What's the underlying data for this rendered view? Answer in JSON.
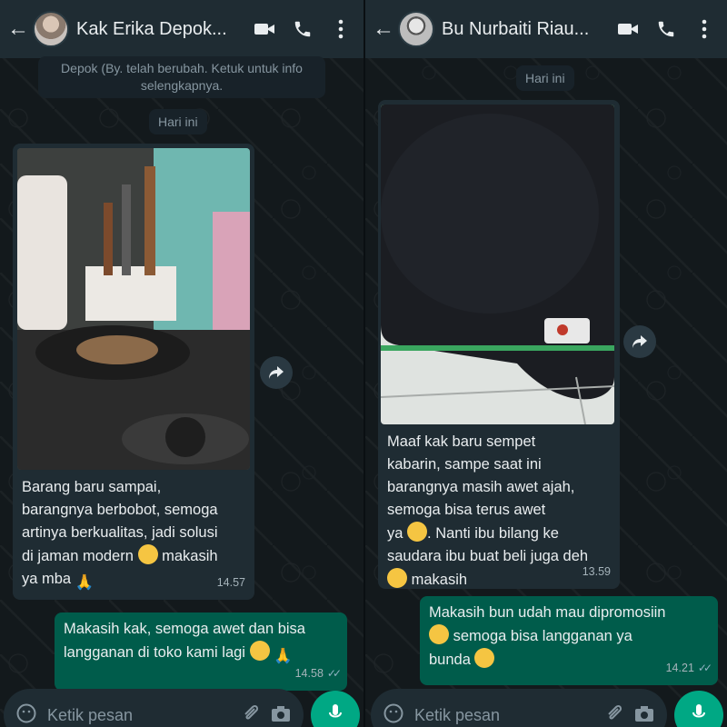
{
  "left": {
    "header": {
      "contact_name": "Kak Erika Depok..."
    },
    "system_note": "Depok (By. telah berubah. Ketuk untuk info selengkapnya.",
    "date_chip": "Hari ini",
    "incoming": {
      "text_l1": "Barang baru sampai,",
      "text_l2": "barangnya berbobot, semoga",
      "text_l3": "artinya berkualitas, jadi solusi",
      "text_l4": "di jaman modern",
      "text_l4b": "makasih",
      "text_l5": "ya mba",
      "time": "14.57"
    },
    "outgoing": {
      "text_l1": "Makasih kak, semoga awet dan bisa",
      "text_l2": "langganan di toko kami lagi",
      "time": "14.58"
    },
    "composer_placeholder": "Ketik pesan"
  },
  "right": {
    "header": {
      "contact_name": "Bu Nurbaiti Riau..."
    },
    "date_chip": "Hari ini",
    "incoming": {
      "text_l1": "Maaf kak baru sempet",
      "text_l2": "kabarin, sampe saat ini",
      "text_l3": "barangnya masih awet ajah,",
      "text_l4": "semoga bisa terus awet",
      "text_l5a": "ya",
      "text_l5b": ". Nanti ibu bilang ke",
      "text_l6": "saudara ibu buat beli juga deh",
      "text_l7": "makasih",
      "time": "13.59"
    },
    "outgoing": {
      "text_l1": "Makasih bun udah mau dipromosiin",
      "text_l2": "semoga bisa langganan ya",
      "text_l3": "bunda",
      "time": "14.21"
    },
    "composer_placeholder": "Ketik pesan"
  },
  "icons": [
    "back-arrow-icon",
    "video-call-icon",
    "phone-icon",
    "more-vert-icon",
    "forward-icon",
    "emoji-icon",
    "attach-icon",
    "camera-icon",
    "mic-icon"
  ],
  "colors": {
    "header": "#1f2c33",
    "incoming": "#1f2c33",
    "outgoing": "#005c4b",
    "accent": "#00a884"
  }
}
